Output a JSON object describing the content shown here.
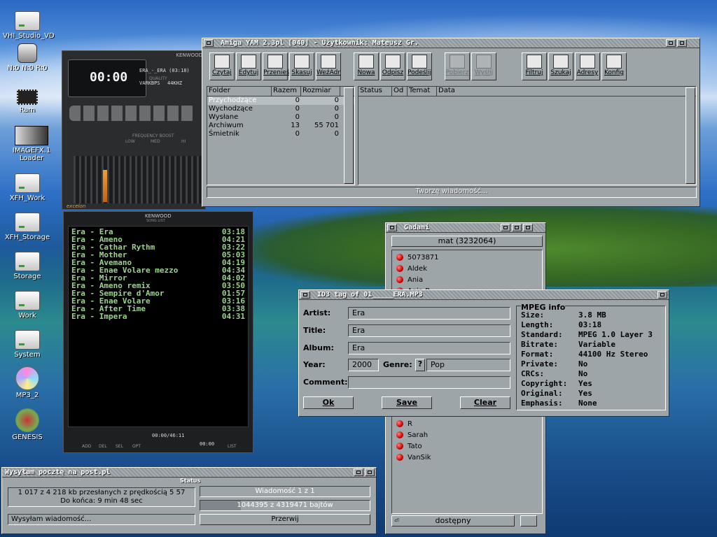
{
  "desktop_icons": [
    {
      "label": "VHI_Studio_VD",
      "icon": "disk-icon"
    },
    {
      "label": "N:0 N:0 R:0",
      "icon": "speaker-icon"
    },
    {
      "label": "Ram",
      "icon": "chip-icon"
    },
    {
      "label": "IMAGEFX.1 Loader",
      "icon": "imagefx-icon"
    },
    {
      "label": "XFH_Work",
      "icon": "disk-icon"
    },
    {
      "label": "XFH_Storage",
      "icon": "disk-icon"
    },
    {
      "label": "Storage",
      "icon": "disk-icon"
    },
    {
      "label": "Work",
      "icon": "disk-icon"
    },
    {
      "label": "System",
      "icon": "disk-icon"
    },
    {
      "label": "MP3_2",
      "icon": "cd-icon"
    },
    {
      "label": "GENESIS",
      "icon": "genesis-icon"
    }
  ],
  "amp": {
    "brand": "KENWOOD",
    "time": "00:00",
    "track": "ERA_-_ERA (03:18)",
    "bitrate": "VARKBPS",
    "freq": "44KHZ",
    "freq_boost": "FREQUENCY BOOST",
    "low": "LOW",
    "med": "MED",
    "hi": "HI",
    "maker": "excelon",
    "quality": "QUALITY"
  },
  "playlist": {
    "brand": "KENWOOD",
    "subtitle": "SONG LIST",
    "time": "00:00/46:11",
    "time2": "00:00",
    "buttons": [
      "ADD",
      "DEL",
      "SEL",
      "OPT",
      "LIST"
    ],
    "items": [
      {
        "title": "Era - Era",
        "time": "03:18"
      },
      {
        "title": "Era - Ameno",
        "time": "04:21"
      },
      {
        "title": "Era - Cathar Rythm",
        "time": "03:22"
      },
      {
        "title": "Era - Mother",
        "time": "05:03"
      },
      {
        "title": "Era - Avemano",
        "time": "04:19"
      },
      {
        "title": "Era - Enae Volare mezzo",
        "time": "04:34"
      },
      {
        "title": "Era - Mirror",
        "time": "04:02"
      },
      {
        "title": "Era - Ameno remix",
        "time": "03:50"
      },
      {
        "title": "Era - Sempire d'Amor",
        "time": "01:57"
      },
      {
        "title": "Era - Enae Volare",
        "time": "03:16"
      },
      {
        "title": "Era - After Time",
        "time": "03:38"
      },
      {
        "title": "Era - Impera",
        "time": "04:31"
      }
    ]
  },
  "yam": {
    "title": "Amiga YAM 2.3pl [040]  -  Użytkownik: Mateusz Gr.",
    "tools": [
      {
        "label": "Czytaj",
        "enabled": true
      },
      {
        "label": "Edytuj",
        "enabled": true
      },
      {
        "label": "Przenieś",
        "enabled": true
      },
      {
        "label": "Skasuj",
        "enabled": true
      },
      {
        "label": "WeźAdr",
        "enabled": true
      },
      {
        "label": "Nowa",
        "enabled": true
      },
      {
        "label": "Odpisz",
        "enabled": true
      },
      {
        "label": "Podeślij",
        "enabled": true
      },
      {
        "label": "Pobierz",
        "enabled": false
      },
      {
        "label": "Wyślij",
        "enabled": false
      },
      {
        "label": "Filtruj",
        "enabled": true
      },
      {
        "label": "Szukaj",
        "enabled": true
      },
      {
        "label": "Adresy",
        "enabled": true
      },
      {
        "label": "Konfig",
        "enabled": true
      }
    ],
    "folder_headers": [
      "Folder",
      "Razem",
      "Rozmiar"
    ],
    "folders": [
      {
        "name": "Przychodzące",
        "total": "0",
        "size": "0",
        "selected": true
      },
      {
        "name": "Wychodzące",
        "total": "0",
        "size": "0"
      },
      {
        "name": "Wysłane",
        "total": "0",
        "size": "0"
      },
      {
        "name": "Archiwum",
        "total": "13",
        "size": "55 701"
      },
      {
        "name": "Śmietnik",
        "total": "0",
        "size": "0"
      }
    ],
    "mail_headers": [
      "Status",
      "Od",
      "Temat",
      "Data"
    ],
    "status": "Tworzę wiadomość..."
  },
  "gadami": {
    "title": "Gadami",
    "account": "mat (3232064)",
    "users_top": [
      "5073871",
      "Aldek",
      "Ania",
      "Ania B"
    ],
    "users_bottom": [
      "R",
      "Sarah",
      "Tato",
      "VanSik"
    ],
    "status": "dostępny"
  },
  "id3": {
    "title": "ID3 tag of 01_____ERA.MP3",
    "artist_label": "Artist:",
    "artist": "Era",
    "title_label": "Title:",
    "title_val": "Era",
    "album_label": "Album:",
    "album": "Era",
    "year_label": "Year:",
    "year": "2000",
    "genre_label": "Genre:",
    "genre_btn": "?",
    "genre": "Pop",
    "comment_label": "Comment:",
    "comment": "",
    "ok": "Ok",
    "save": "Save",
    "clear": "Clear",
    "mpeg_title": "MPEG info",
    "info": [
      {
        "k": "Size:",
        "v": "3.8 MB"
      },
      {
        "k": "Length:",
        "v": "03:18"
      },
      {
        "k": "Standard:",
        "v": "MPEG 1.0 Layer 3"
      },
      {
        "k": "Bitrate:",
        "v": "Variable"
      },
      {
        "k": "Format:",
        "v": "44100 Hz Stereo"
      },
      {
        "k": "Private:",
        "v": "No"
      },
      {
        "k": "CRCs:",
        "v": "No"
      },
      {
        "k": "Copyright:",
        "v": "Yes"
      },
      {
        "k": "Original:",
        "v": "Yes"
      },
      {
        "k": "Emphasis:",
        "v": "None"
      }
    ]
  },
  "send": {
    "title": "Wysyłam pocztę na post.pl",
    "group": "Status",
    "progress_text": "1 017 z 4 218 kb przesłanych z prędkością 5 57",
    "remaining": "Do końca: 9 min 48 sec",
    "msg": "Wiadomość 1 z 1",
    "bytes": "1044395 z 4319471 bajtów",
    "bytes_progress": 0.24,
    "state": "Wysyłam wiadomość...",
    "abort": "Przerwij"
  }
}
